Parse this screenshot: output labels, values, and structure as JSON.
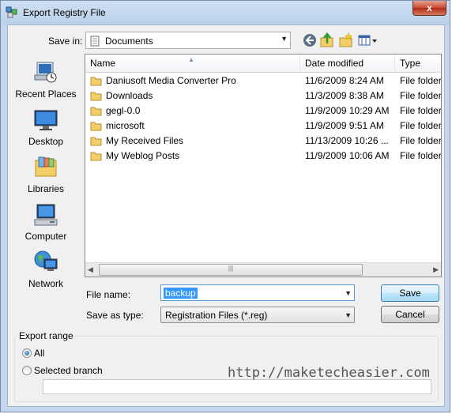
{
  "window": {
    "title": "Export Registry File",
    "close_label": "x"
  },
  "toolbar": {
    "save_in_label": "Save in:",
    "save_in_value": "Documents",
    "icons": [
      "back-icon",
      "up-folder-icon",
      "new-folder-icon",
      "view-menu-icon"
    ]
  },
  "places": [
    {
      "label": "Recent Places",
      "icon": "recent-places-icon"
    },
    {
      "label": "Desktop",
      "icon": "desktop-icon"
    },
    {
      "label": "Libraries",
      "icon": "libraries-icon"
    },
    {
      "label": "Computer",
      "icon": "computer-icon"
    },
    {
      "label": "Network",
      "icon": "network-icon"
    }
  ],
  "file_list": {
    "columns": [
      "Name",
      "Date modified",
      "Type"
    ],
    "rows": [
      {
        "name": "Daniusoft Media Converter Pro",
        "date": "11/6/2009 8:24 AM",
        "type": "File folder"
      },
      {
        "name": "Downloads",
        "date": "11/3/2009 8:38 AM",
        "type": "File folder"
      },
      {
        "name": "gegl-0.0",
        "date": "11/9/2009 10:29 AM",
        "type": "File folder"
      },
      {
        "name": "microsoft",
        "date": "11/9/2009 9:51 AM",
        "type": "File folder"
      },
      {
        "name": "My Received Files",
        "date": "11/13/2009 10:26 ...",
        "type": "File folder"
      },
      {
        "name": "My Weblog Posts",
        "date": "11/9/2009 10:06 AM",
        "type": "File folder"
      }
    ]
  },
  "form": {
    "file_name_label": "File name:",
    "file_name_value": "backup",
    "save_as_type_label": "Save as type:",
    "save_as_type_value": "Registration Files (*.reg)",
    "save_button": "Save",
    "cancel_button": "Cancel"
  },
  "export_range": {
    "label": "Export range",
    "options": [
      {
        "label": "All",
        "selected": true
      },
      {
        "label": "Selected branch",
        "selected": false
      }
    ],
    "branch_value": ""
  },
  "watermark": "http://maketecheasier.com",
  "colors": {
    "frame": "#b9d1ea",
    "selection": "#3399ff",
    "folder": "#f3cf6a"
  }
}
